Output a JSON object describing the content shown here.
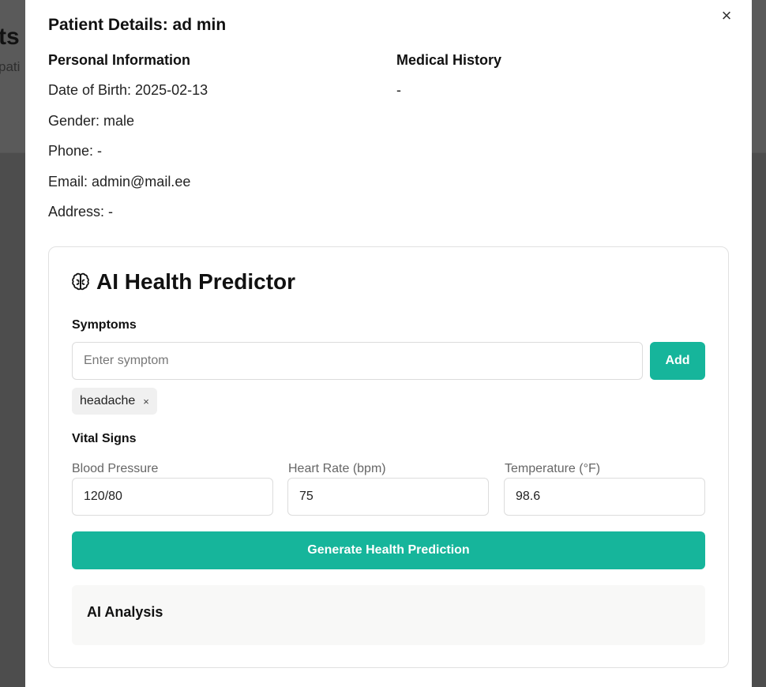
{
  "background": {
    "title_fragment": "ts",
    "subtitle_fragment": "pati"
  },
  "modal": {
    "title": "Patient Details: ad min",
    "close_symbol": "×",
    "personal_info": {
      "heading": "Personal Information",
      "date_of_birth": "Date of Birth: 2025-02-13",
      "gender": "Gender: male",
      "phone": "Phone: -",
      "email": "Email: admin@mail.ee",
      "address": "Address: -"
    },
    "medical_history": {
      "heading": "Medical History",
      "value": "-"
    }
  },
  "predictor": {
    "icon": "brain-icon",
    "title": "AI Health Predictor",
    "symptoms_label": "Symptoms",
    "symptom_placeholder": "Enter symptom",
    "add_label": "Add",
    "symptoms": [
      "headache"
    ],
    "chip_remove_symbol": "×",
    "vital_signs_label": "Vital Signs",
    "vitals": {
      "blood_pressure_label": "Blood Pressure",
      "blood_pressure_value": "120/80",
      "heart_rate_label": "Heart Rate (bpm)",
      "heart_rate_value": "75",
      "temperature_label": "Temperature (°F)",
      "temperature_value": "98.6"
    },
    "generate_label": "Generate Health Prediction",
    "analysis_title": "AI Analysis"
  },
  "colors": {
    "accent": "#16b59b",
    "overlay": "#4d4d4d",
    "analysis_bg": "#f8f8f7"
  }
}
